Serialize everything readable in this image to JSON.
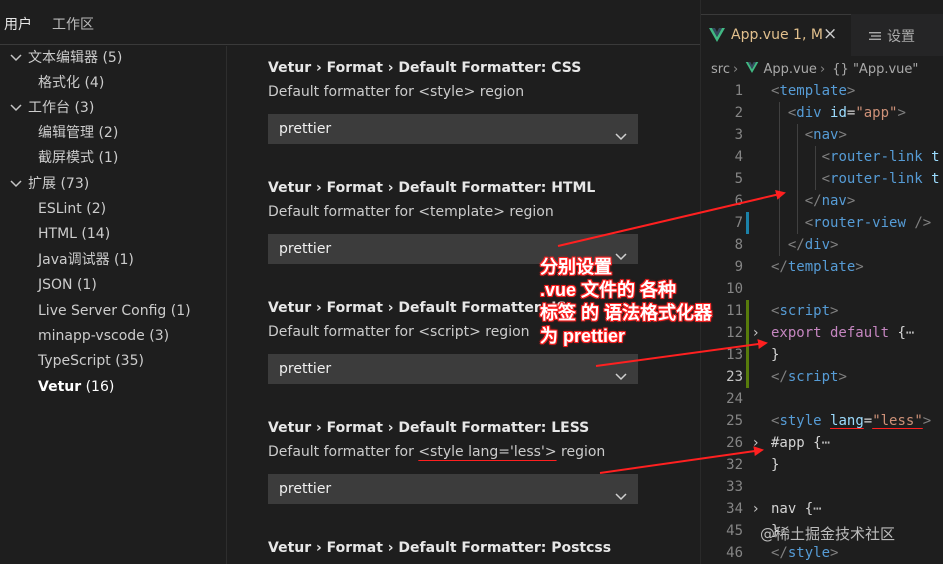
{
  "settings_tabs": {
    "user": "用户",
    "workspace": "工作区"
  },
  "toc": [
    {
      "label": "文本编辑器",
      "count": "(5)",
      "chevron": "expanded"
    },
    {
      "label": "格式化",
      "count": "(4)"
    },
    {
      "label": "工作台",
      "count": "(3)",
      "chevron": "expanded"
    },
    {
      "label": "编辑管理",
      "count": "(2)"
    },
    {
      "label": "截屏模式",
      "count": "(1)"
    },
    {
      "label": "扩展",
      "count": "(73)",
      "chevron": "expanded"
    },
    {
      "label": "ESLint",
      "count": "(2)"
    },
    {
      "label": "HTML",
      "count": "(14)"
    },
    {
      "label": "Java调试器",
      "count": "(1)"
    },
    {
      "label": "JSON",
      "count": "(1)"
    },
    {
      "label": "Live Server Config",
      "count": "(1)"
    },
    {
      "label": "minapp-vscode",
      "count": "(3)"
    },
    {
      "label": "TypeScript",
      "count": "(35)"
    },
    {
      "label": "Vetur",
      "count": "(16)",
      "selected": true
    }
  ],
  "settings": [
    {
      "title": "Vetur › Format › Default Formatter: CSS",
      "description": "Default formatter for <style> region",
      "value": "prettier"
    },
    {
      "title": "Vetur › Format › Default Formatter: HTML",
      "description": "Default formatter for <template> region",
      "value": "prettier"
    },
    {
      "title": "Vetur › Format › Default Formatter: JS",
      "description": "Default formatter for <script> region",
      "value": "prettier"
    },
    {
      "title": "Vetur › Format › Default Formatter: LESS",
      "description_prefix": "Default formatter for ",
      "description_code": "<style lang='less'>",
      "description_suffix": " region",
      "value": "prettier"
    },
    {
      "title": "Vetur › Format › Default Formatter: Postcss"
    }
  ],
  "editor": {
    "tab_file": "App.vue",
    "tab_status": "1, M",
    "tab_close": "×",
    "tab_settings": "设置",
    "breadcrumb": [
      "src",
      "App.vue",
      "{} \"App.vue\""
    ],
    "lines": [
      "1",
      "2",
      "3",
      "4",
      "5",
      "6",
      "7",
      "8",
      "9",
      "10",
      "11",
      "12",
      "13",
      "23",
      "24",
      "25",
      "26",
      "32",
      "33",
      "34",
      "45",
      "46"
    ],
    "code": {
      "l1_tag": "template",
      "l2_tag": "div",
      "l2_attr": "id",
      "l2_val": "\"app\"",
      "l3_tag": "nav",
      "l4_tag": "router-link",
      "l4_rest": "t",
      "l5_tag": "router-link",
      "l5_rest": "t",
      "l6_tag": "nav",
      "l7_tag": "router-view",
      "l8_tag": "div",
      "l9_tag": "template",
      "l11_tag": "script",
      "l12_kw": "export default",
      "l12_rest": " {",
      "ellipsis": "⋯",
      "l13_text": "}",
      "l23_tag": "script",
      "l25_tag": "style",
      "l25_attr": "lang",
      "l25_val": "\"less\"",
      "l26_sel": "#app",
      "l26_rest": " {",
      "l32_text": "}",
      "l34_sel": "nav",
      "l34_rest": " {",
      "l45_text": "}",
      "l46_tag": "style"
    }
  },
  "annotation": "分别设置\n.vue 文件的 各种\n标签 的 语法格式化器\n为 prettier",
  "watermark": "@稀土掘金技术社区",
  "colors": {
    "annotation_red": "#ff2020",
    "modified_file": "#e2c08d",
    "vue_green": "#41b883"
  }
}
